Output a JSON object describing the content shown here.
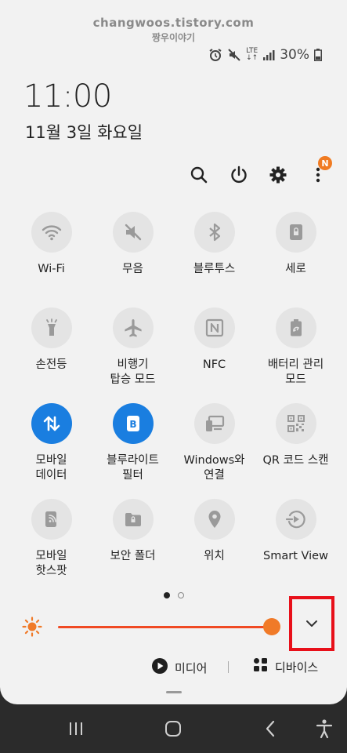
{
  "watermark": {
    "line1": "changwoos.tistory.com",
    "line2": "짱우이야기"
  },
  "status_bar": {
    "battery_text": "30%",
    "network_label": "LTE"
  },
  "clock": {
    "time": "11:00",
    "date": "11월 3일 화요일"
  },
  "top_actions": {
    "notification_badge": "N"
  },
  "tiles": {
    "wifi": "Wi-Fi",
    "mute": "무음",
    "bluetooth": "블루투스",
    "rotation": "세로",
    "flashlight": "손전등",
    "airplane_line1": "비행기",
    "airplane_line2": "탑승 모드",
    "nfc": "NFC",
    "battery_line1": "배터리 관리",
    "battery_line2": "모드",
    "mobile_data_line1": "모바일",
    "mobile_data_line2": "데이터",
    "bluelight_line1": "블루라이트",
    "bluelight_line2": "필터",
    "windows_line1": "Windows와",
    "windows_line2": "연결",
    "qr": "QR 코드 스캔",
    "hotspot_line1": "모바일",
    "hotspot_line2": "핫스팟",
    "secure_folder": "보안 폴더",
    "location": "위치",
    "smart_view": "Smart View"
  },
  "brightness": {
    "level": 0.9
  },
  "media_row": {
    "media_label": "미디어",
    "devices_label": "디바이스"
  },
  "colors": {
    "accent_blue": "#1a7ee0",
    "brightness_orange": "#f07a28",
    "highlight_red": "#e8101a"
  },
  "icons": [
    "wifi-icon",
    "mute-icon",
    "bluetooth-icon",
    "rotation-lock-icon",
    "flashlight-icon",
    "airplane-icon",
    "nfc-icon",
    "battery-saver-icon",
    "mobile-data-icon",
    "blue-light-filter-icon",
    "windows-link-icon",
    "qr-scan-icon",
    "hotspot-icon",
    "secure-folder-icon",
    "location-icon",
    "smart-view-icon",
    "search-icon",
    "power-icon",
    "gear-icon",
    "more-icon",
    "sun-icon",
    "chevron-down-icon",
    "play-icon",
    "devices-icon"
  ]
}
